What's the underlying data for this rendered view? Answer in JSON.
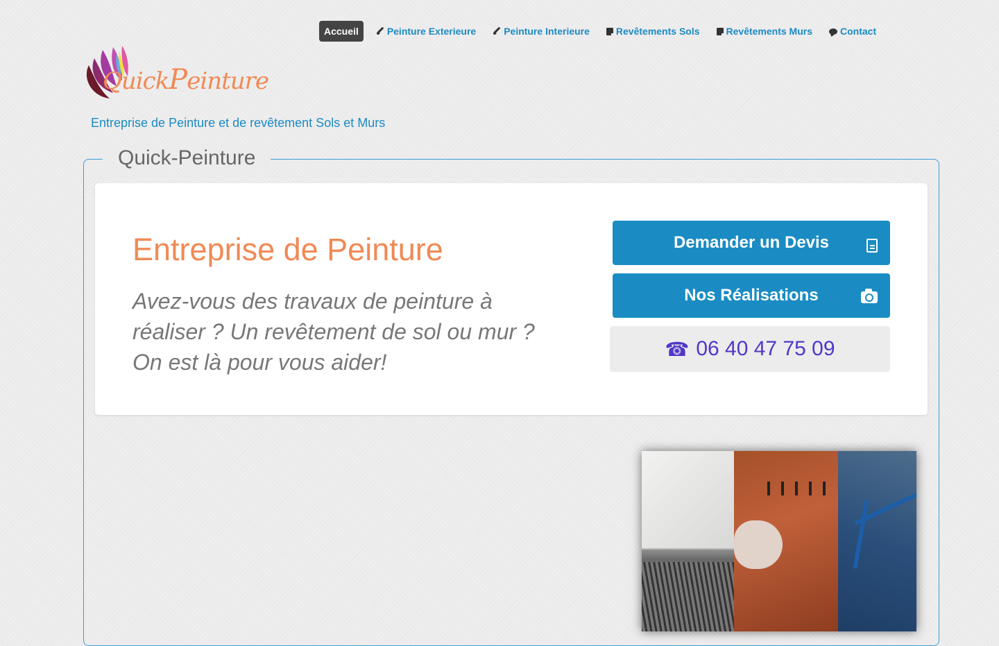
{
  "nav": {
    "items": [
      {
        "label": "Accueil",
        "icon": "",
        "active": true
      },
      {
        "label": "Peinture Exterieure",
        "icon": "brush-icon"
      },
      {
        "label": "Peinture Interieure",
        "icon": "brush-icon"
      },
      {
        "label": "Revêtements Sols",
        "icon": "tile-icon"
      },
      {
        "label": "Revêtements Murs",
        "icon": "tile-icon"
      },
      {
        "label": "Contact",
        "icon": "chat-bubble-icon"
      }
    ]
  },
  "brand": {
    "name_part1": "Quick",
    "name_part2": "P",
    "name_part3": "einture",
    "tagline": "Entreprise de Peinture et de revêtement Sols et Murs",
    "accent_color": "#f08a55",
    "link_color": "#1c8ac2"
  },
  "section": {
    "legend": "Quick-Peinture"
  },
  "hero": {
    "title": "Entreprise de Peinture",
    "text": "Avez-vous des travaux de peinture à réaliser ? Un revêtement de sol ou mur ? On est là pour vous aider!"
  },
  "actions": {
    "devis_label": "Demander un Devis",
    "devis_icon": "document-icon",
    "realisations_label": "Nos Réalisations",
    "realisations_icon": "camera-icon",
    "phone_icon": "phone-icon",
    "phone_number": "06 40 47 75 09",
    "button_color": "#1a8cc3",
    "phone_color": "#5236c9"
  }
}
